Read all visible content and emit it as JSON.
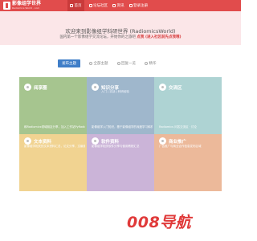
{
  "header": {
    "logo_text": "影像组学世界",
    "logo_sub": "Radiomics World · com",
    "nav": [
      {
        "label": "首页",
        "icon": "home-icon"
      },
      {
        "label": "论坛社区",
        "icon": "chat-icon"
      },
      {
        "label": "资讯",
        "icon": "news-icon"
      },
      {
        "label": "登录注册",
        "icon": "user-icon"
      }
    ],
    "brand_color": "#e14c4c"
  },
  "hero": {
    "title": "欢迎来到影像组学科研世界 (RadiomicsWorld)",
    "desc_before": "国内第一个影像组学交流论坛，开始你的之旅吧",
    "desc_link": "点我 (进入社区前先点我哦)",
    "background": "#fbe6e8"
  },
  "tabs": [
    {
      "label": "发布主题",
      "active": true
    },
    {
      "label": "全部主题",
      "active": false
    },
    {
      "label": "回复一览",
      "active": false
    },
    {
      "label": "精华",
      "active": false
    }
  ],
  "cards": [
    {
      "title": "阅享圈",
      "subtitle": "",
      "desc": "和Radiomics领域朋友分享，加入工作站PyRadiomics…",
      "color": "#a6c58f",
      "icon": "lightbulb-icon"
    },
    {
      "title": "知识分享",
      "subtitle": "入门 | 实战 | 科研经验",
      "desc": "影像组学入门知识，基于影像组学的深度学习和机器学习相关讨论",
      "color": "#9fb7cc",
      "icon": "share-icon"
    },
    {
      "title": "交流区",
      "subtitle": "",
      "desc": "Radiomics 问答交流区 · 讨论",
      "color": "#aed3d3",
      "icon": "chat-bubble-icon"
    },
    {
      "title": "文本资料",
      "subtitle": "",
      "desc": "影像组学相关的文本资料汇总，论文分享，文献综述等",
      "color": "#f1d391",
      "icon": "document-icon"
    },
    {
      "title": "软件资料",
      "subtitle": "",
      "desc": "影像组学相关软件分享与使用教程汇总",
      "color": "#cbb4d8",
      "icon": "software-icon"
    },
    {
      "title": "商业推广",
      "subtitle": "",
      "desc": "广告推广与商业合作信息发布区域",
      "color": "#ecb99a",
      "icon": "megaphone-icon"
    }
  ],
  "watermark": "008导航"
}
